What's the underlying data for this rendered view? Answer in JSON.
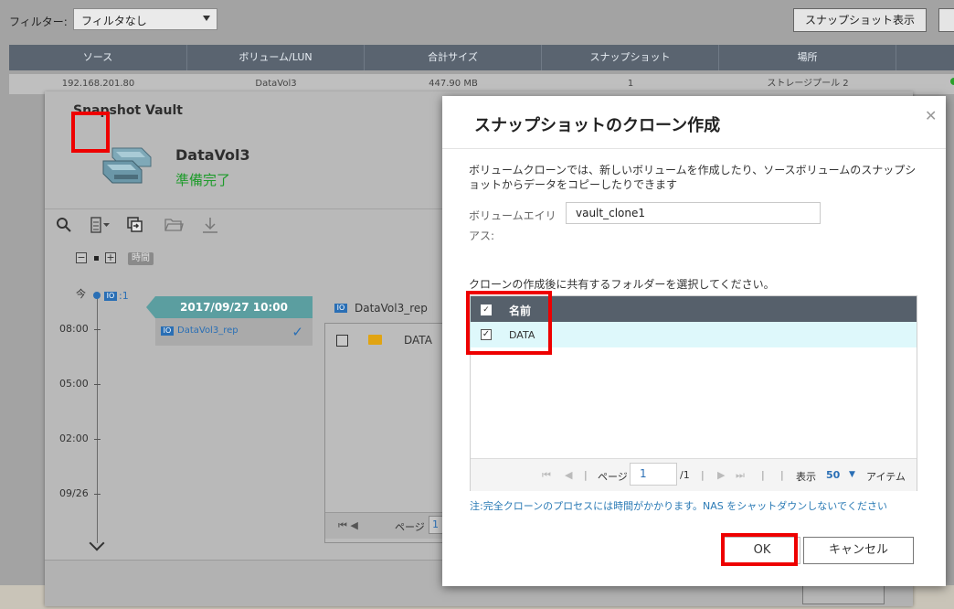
{
  "filter": {
    "label": "フィルター:",
    "value": "フィルタなし"
  },
  "toolbar": {
    "snapshot_button": "スナップショット表示"
  },
  "grid": {
    "headers": [
      "ソース",
      "ボリューム/LUN",
      "合計サイズ",
      "スナップショット",
      "場所"
    ],
    "row": [
      "192.168.201.80",
      "DataVol3",
      "447.90 MB",
      "1",
      "ストレージプール 2"
    ]
  },
  "vault": {
    "title": "Snapshot Vault",
    "volume_name": "DataVol3",
    "volume_status": "準備完了",
    "time_badge": "時間",
    "now_label": "今",
    "now_snapshot_count": ":1",
    "timeline_ticks": [
      "08:00",
      "05:00",
      "02:00",
      "09/26"
    ],
    "snapshot_card": {
      "date": "2017/09/27 10:00",
      "name": "DataVol3_rep"
    },
    "files": {
      "title": "DataVol3_rep",
      "folder": "DATA",
      "pager_label": "ページ",
      "pager_value": "1"
    }
  },
  "dialog": {
    "title": "スナップショットのクローン作成",
    "description": "ボリュームクローンでは、新しいボリュームを作成したり、ソースボリュームのスナップショットからデータをコピーしたりできます",
    "alias_label": "ボリュームエイリアス:",
    "alias_value": "vault_clone1",
    "folder_prompt": "クローンの作成後に共有するフォルダーを選択してください。",
    "grid_header": "名前",
    "folders": [
      "DATA"
    ],
    "pager": {
      "page_label": "ページ",
      "page_value": "1",
      "page_total": "/1",
      "display_label": "表示",
      "per_page": "50",
      "items_label": "アイテム"
    },
    "note": "注:完全クローンのプロセスには時間がかかります。NAS をシャットダウンしないでください",
    "ok_label": "OK",
    "cancel_label": "キャンセル"
  },
  "colors": {
    "accent_blue": "#2a6fb5",
    "status_green": "#1d9b2a",
    "highlight_red": "#ee0000",
    "header_slate": "#56606b",
    "teal": "#5b9ea0"
  }
}
